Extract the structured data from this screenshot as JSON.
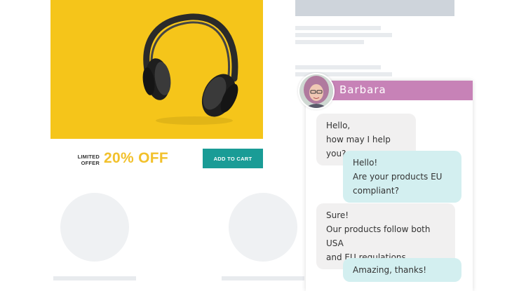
{
  "product": {
    "offer_label": "LIMITED\nOFFER",
    "discount": "20% OFF",
    "cart_button": "ADD TO CART",
    "image_icon": "headphones-icon"
  },
  "chat": {
    "agent_name": "Barbara",
    "header_color": "#c782b7",
    "messages": [
      {
        "from": "agent",
        "text": "Hello,\nhow may I help you?"
      },
      {
        "from": "user",
        "text": "Hello!\nAre your products EU\ncompliant?"
      },
      {
        "from": "agent",
        "text": "Sure!\nOur products follow both USA\nand EU regulations."
      },
      {
        "from": "user",
        "text": "Amazing, thanks!"
      }
    ]
  },
  "colors": {
    "accent_yellow": "#f2c12c",
    "button_teal": "#1a9c96",
    "user_bubble": "#d3eff0",
    "agent_bubble": "#f1f0f0"
  }
}
